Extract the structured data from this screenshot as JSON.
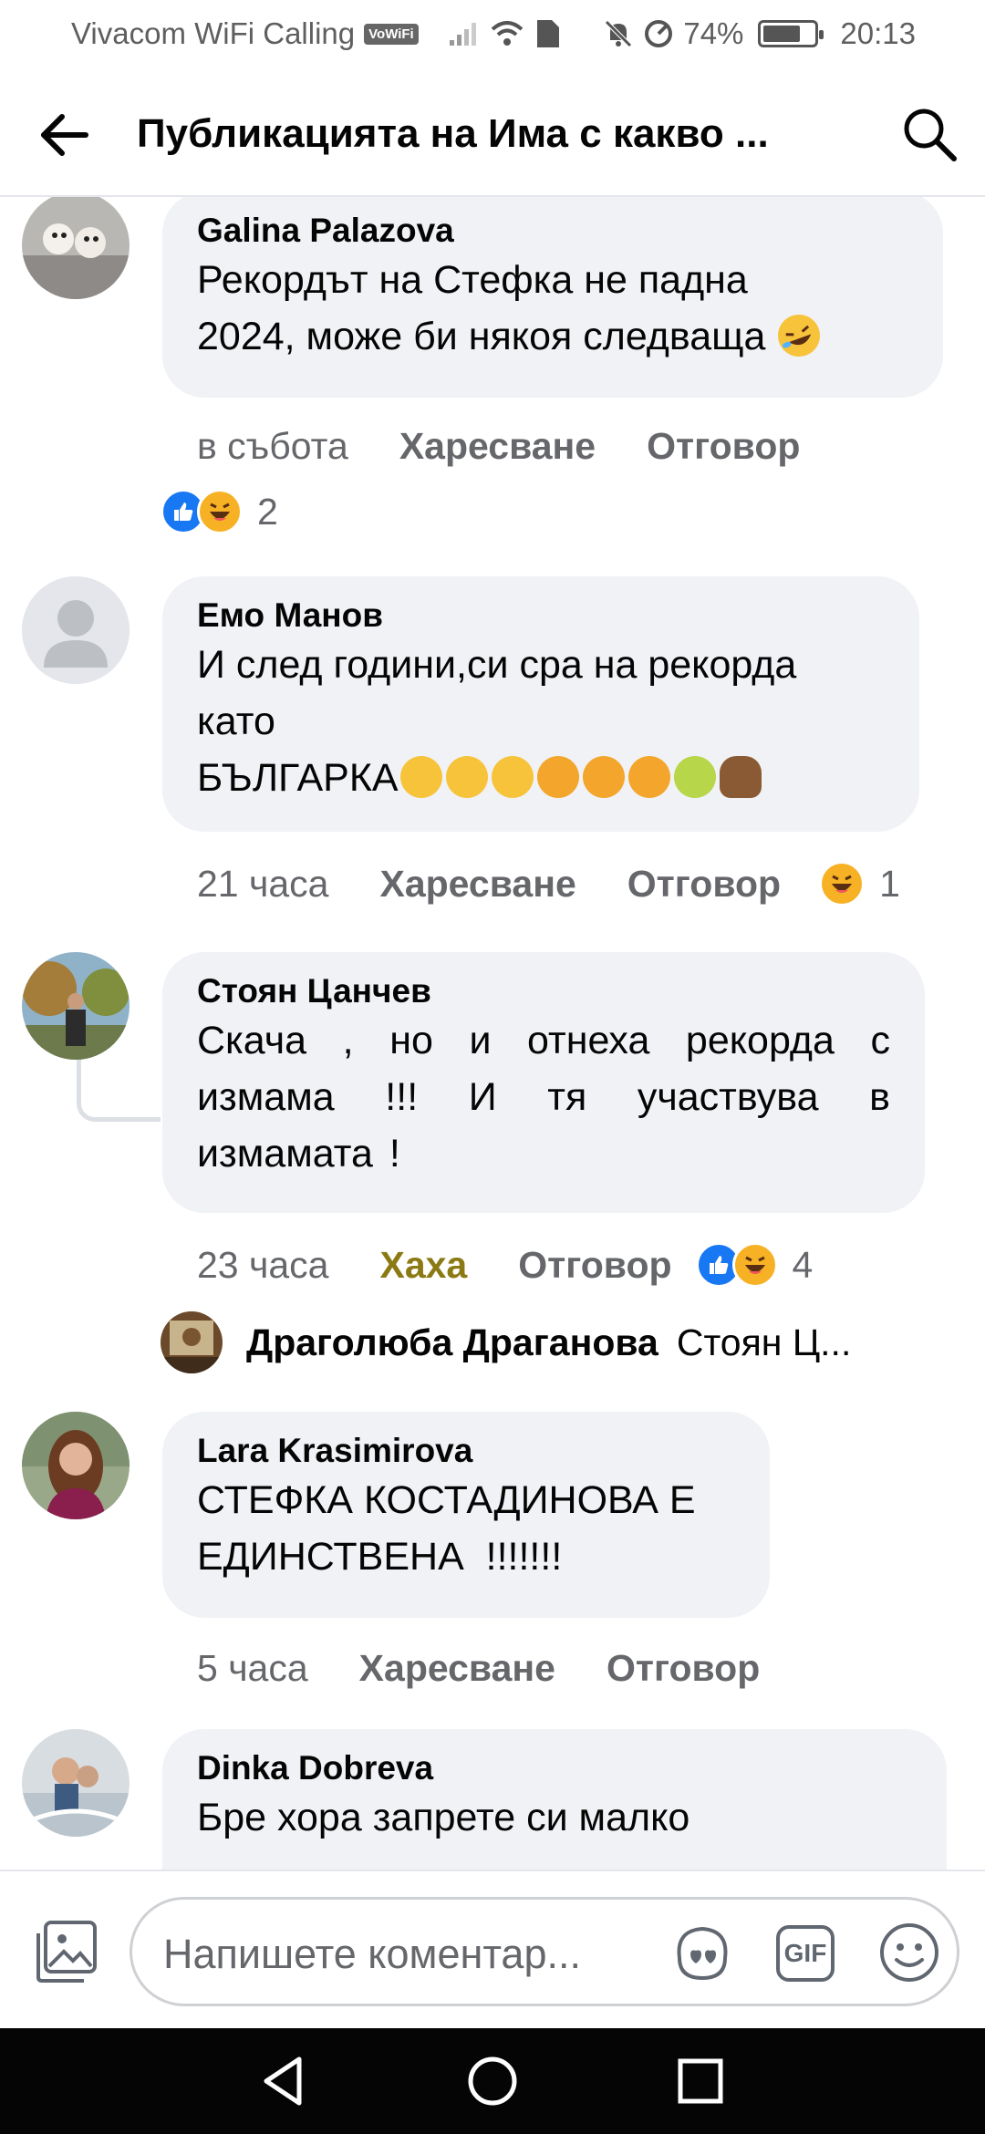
{
  "status_bar": {
    "carrier": "Vivacom WiFi Calling",
    "vowifi_badge": "VoWiFi",
    "battery_percent": "74%",
    "battery_level": 0.74,
    "time": "20:13"
  },
  "header": {
    "title": "Публикацията на Има с какво ..."
  },
  "comments": [
    {
      "author": "Galina Palazova",
      "text_lines": [
        "Рекордът на Стефка не падна",
        "2024, може би някоя следваща"
      ],
      "text_emojis": [
        "rolling-on-floor-laughing"
      ],
      "time": "в събота",
      "like_label": "Харесване",
      "reply_label": "Отговор",
      "reactions": [
        "like",
        "haha"
      ],
      "reaction_count": "2"
    },
    {
      "author": "Емо Манов",
      "text_lines": [
        "И след години,си сра на рекорда",
        "като",
        "БЪЛГАРКА"
      ],
      "text_emojis": [
        "sleepy-face",
        "sleepy-face",
        "sleepy-face",
        "pouting-face",
        "pouting-face",
        "pouting-face",
        "nauseated-face",
        "pile-of-poo"
      ],
      "time": "21 часа",
      "like_label": "Харесване",
      "reply_label": "Отговор",
      "reactions": [
        "haha"
      ],
      "reaction_count": "1"
    },
    {
      "author": "Стоян Цанчев",
      "text": "Скача , но и отнеха рекорда с измама !!! И тя участвува в измамата !",
      "time": "23 часа",
      "like_label": "Хаха",
      "reply_label": "Отговор",
      "reactions": [
        "like",
        "haha"
      ],
      "reaction_count": "4",
      "reply": {
        "author": "Драголюба Драганова",
        "preview": "Стоян Ц..."
      }
    },
    {
      "author": "Lara Krasimirova",
      "text_lines": [
        "СТЕФКА КОСТАДИНОВА Е",
        "ЕДИНСТВЕНА  !!!!!!!"
      ],
      "time": "5 часа",
      "like_label": "Харесване",
      "reply_label": "Отговор"
    },
    {
      "author": "Dinka Dobreva",
      "text_lines": [
        "Бре хора запрете си малко"
      ]
    }
  ],
  "composer": {
    "placeholder": "Напишете коментар...",
    "gif_label": "GIF"
  }
}
